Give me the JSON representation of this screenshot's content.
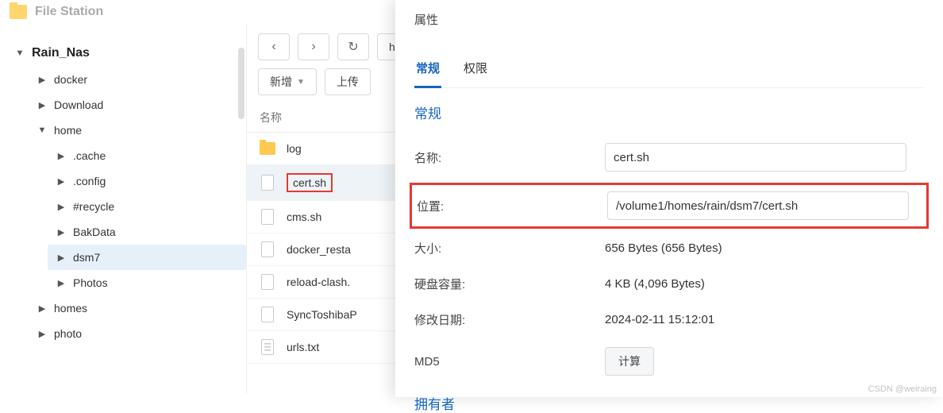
{
  "header": {
    "title": "File Station"
  },
  "sidebar": {
    "root": "Rain_Nas",
    "items": [
      {
        "label": "docker",
        "level": 1,
        "expanded": false
      },
      {
        "label": "Download",
        "level": 1,
        "expanded": false
      },
      {
        "label": "home",
        "level": 1,
        "expanded": true
      },
      {
        "label": ".cache",
        "level": 2,
        "expanded": false
      },
      {
        "label": ".config",
        "level": 2,
        "expanded": false
      },
      {
        "label": "#recycle",
        "level": 2,
        "expanded": false
      },
      {
        "label": "BakData",
        "level": 2,
        "expanded": false
      },
      {
        "label": "dsm7",
        "level": 2,
        "expanded": false,
        "selected": true
      },
      {
        "label": "Photos",
        "level": 2,
        "expanded": false
      },
      {
        "label": "homes",
        "level": 1,
        "expanded": false
      },
      {
        "label": "photo",
        "level": 1,
        "expanded": false
      }
    ]
  },
  "toolbar": {
    "back_icon": "‹",
    "forward_icon": "›",
    "refresh_icon": "↻",
    "path_fragment": "h",
    "add_label": "新增",
    "upload_label": "上传"
  },
  "filelist": {
    "column_name": "名称",
    "rows": [
      {
        "name": "log",
        "type": "folder"
      },
      {
        "name": "cert.sh",
        "type": "file",
        "selected": true
      },
      {
        "name": "cms.sh",
        "type": "file"
      },
      {
        "name": "docker_resta",
        "type": "file"
      },
      {
        "name": "reload-clash.",
        "type": "file"
      },
      {
        "name": "SyncToshibaP",
        "type": "file"
      },
      {
        "name": "urls.txt",
        "type": "text"
      }
    ]
  },
  "panel": {
    "title": "属性",
    "tabs": {
      "general": "常规",
      "permission": "权限"
    },
    "section_general": "常规",
    "labels": {
      "name": "名称:",
      "location": "位置:",
      "size": "大小:",
      "disk": "硬盘容量:",
      "modified": "修改日期:",
      "md5": "MD5"
    },
    "values": {
      "name": "cert.sh",
      "location": "/volume1/homes/rain/dsm7/cert.sh",
      "size": "656 Bytes (656 Bytes)",
      "disk": "4 KB (4,096 Bytes)",
      "modified": "2024-02-11 15:12:01",
      "md5_button": "计算"
    },
    "section_owner": "拥有者"
  },
  "watermark": "CSDN @weiraing"
}
